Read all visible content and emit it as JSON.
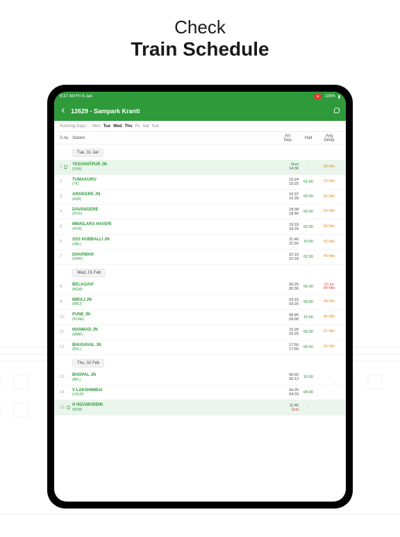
{
  "hero": {
    "line1": "Check",
    "line2": "Train Schedule"
  },
  "statusbar": {
    "time": "9:37 AM  Fri 6 Jan",
    "battery": "100%"
  },
  "appbar": {
    "title": "12629 - Sampark Kranti"
  },
  "daysrow": {
    "label": "Running Days :",
    "days": [
      "Mon",
      "Tue",
      "Wed",
      "Thu",
      "Fri",
      "Sat",
      "Sun"
    ],
    "highlight_idx": [
      1,
      2,
      3
    ]
  },
  "columns": {
    "sno": "S.no",
    "station": "Station",
    "arr": "Arr.\nDep.",
    "halt": "Halt",
    "delay": "Avg\nDelay"
  },
  "sections": [
    {
      "date": "Tue, 31 Jan",
      "rows": [
        {
          "sno": "1",
          "name": "YESVANTPUR JN",
          "code": "(YPR)",
          "arr": "Start",
          "dep": "14:30",
          "halt": "-",
          "delay": "08 Min",
          "highlight": true,
          "origin": true
        },
        {
          "sno": "2",
          "name": "TUMAKURU",
          "code": "(TK)",
          "arr": "15:24",
          "dep": "15:25",
          "halt": "01:00",
          "delay": "23 Min"
        },
        {
          "sno": "3",
          "name": "ARSIKERE JN",
          "code": "(ASK)",
          "arr": "16:37",
          "dep": "16:39",
          "halt": "02:00",
          "delay": "55 Min"
        },
        {
          "sno": "4",
          "name": "DAVANGERE",
          "code": "(DVG)",
          "arr": "18:38",
          "dep": "18:40",
          "halt": "02:00",
          "delay": "50 Min"
        },
        {
          "sno": "5",
          "name": "MMAILARA HAVERI",
          "code": "(HVR)",
          "arr": "19:18",
          "dep": "19:20",
          "halt": "02:00",
          "delay": "40 Min"
        },
        {
          "sno": "6",
          "name": "SSS HUBBALLI JN",
          "code": "(UBL)",
          "arr": "21:40",
          "dep": "21:50",
          "halt": "10:00",
          "delay": "43 Min"
        },
        {
          "sno": "7",
          "name": "DHARWAR",
          "code": "(DWR)",
          "arr": "22:16",
          "dep": "22:18",
          "halt": "02:00",
          "delay": "44 Min"
        }
      ]
    },
    {
      "date": "Wed, 01 Feb",
      "rows": [
        {
          "sno": "8",
          "name": "BELAGAVI",
          "code": "(BGM)",
          "arr": "00:25",
          "dep": "00:30",
          "halt": "05:00",
          "delay": "01 Hr\n04 Min",
          "delay_red": true
        },
        {
          "sno": "9",
          "name": "MIRAJ JN",
          "code": "(MRJ)",
          "arr": "03:15",
          "dep": "03:20",
          "halt": "05:00",
          "delay": "38 Min"
        },
        {
          "sno": "10",
          "name": "PUNE JN",
          "code": "(PUNE)",
          "arr": "08:45",
          "dep": "09:00",
          "halt": "15:00",
          "delay": "45 Min"
        },
        {
          "sno": "11",
          "name": "MANMAD JN",
          "code": "(MMR)",
          "arr": "15:20",
          "dep": "15:25",
          "halt": "05:00",
          "delay": "32 Min"
        },
        {
          "sno": "12",
          "name": "BHUSAVAL JN",
          "code": "(BSL)",
          "arr": "17:50",
          "dep": "17:55",
          "halt": "05:00",
          "delay": "40 Min"
        }
      ]
    },
    {
      "date": "Thu, 02 Feb",
      "rows": [
        {
          "sno": "13",
          "name": "BHOPAL  JN",
          "code": "(BPL)",
          "arr": "00:02",
          "dep": "00:12",
          "halt": "10:00",
          "delay": "-"
        },
        {
          "sno": "14",
          "name": "V LAKSHMIBAI",
          "code": "(VGLB)",
          "arr": "04:25",
          "dep": "04:33",
          "halt": "08:00",
          "delay": "-"
        },
        {
          "sno": "15",
          "name": "H NIZAMUDDIN",
          "code": "(NZM)",
          "arr": "11:40",
          "dep": "End",
          "halt": "-",
          "delay": "-",
          "highlight": true,
          "terminus": true
        }
      ]
    }
  ]
}
